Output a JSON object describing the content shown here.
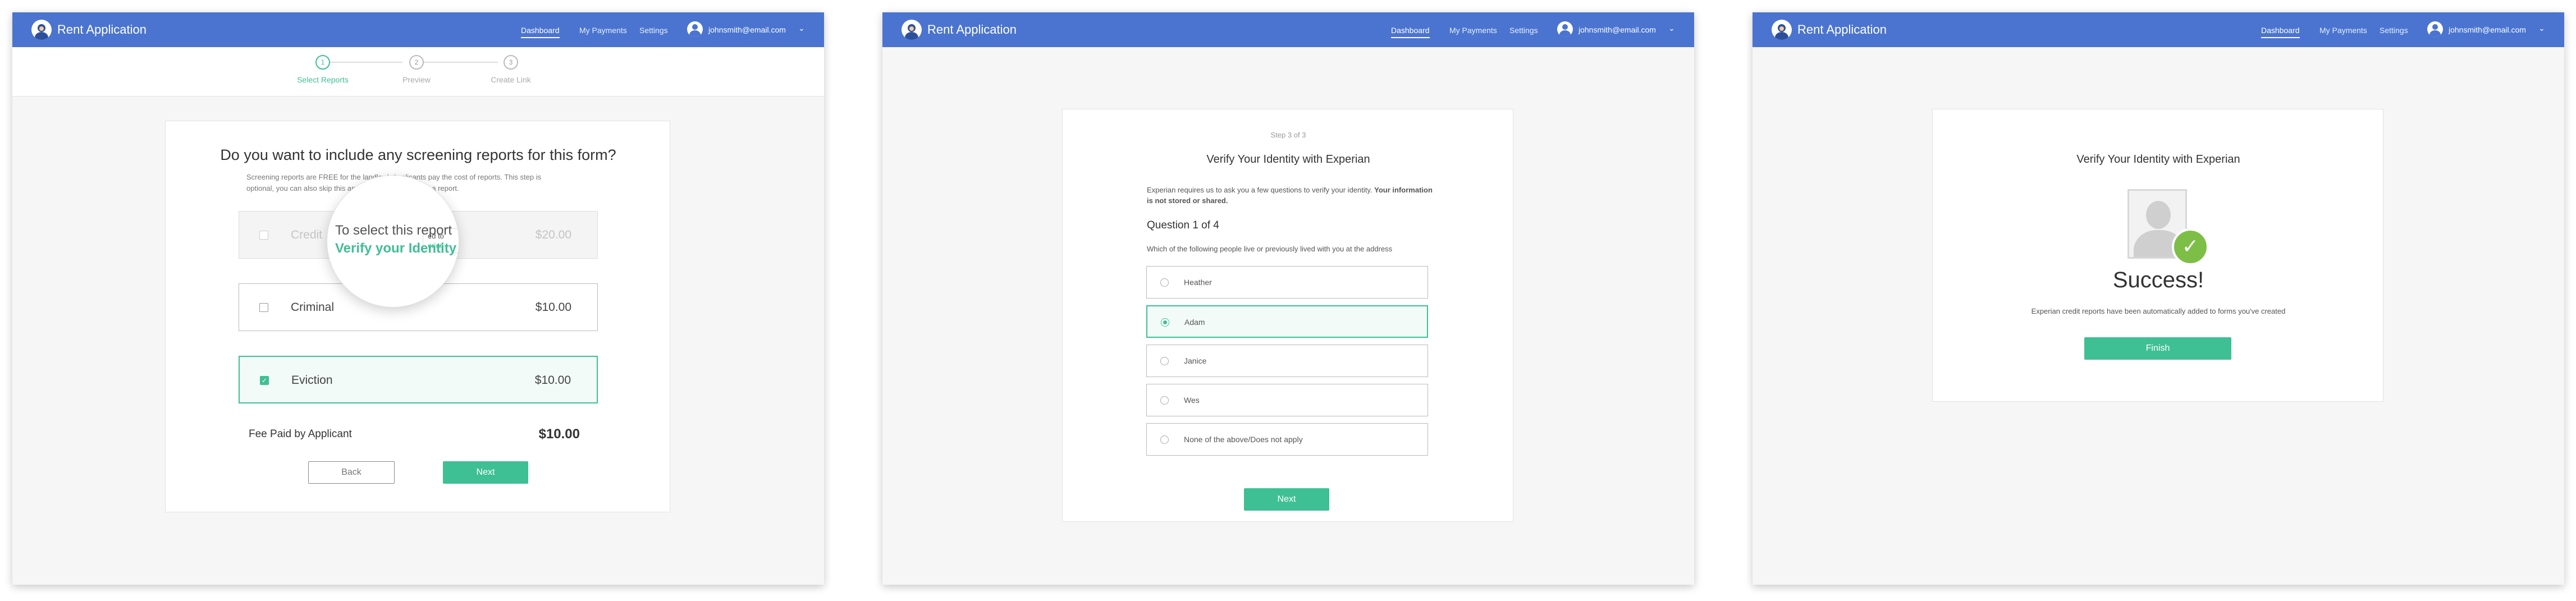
{
  "header": {
    "app_title": "Rent Application",
    "nav": [
      "Dashboard",
      "My Payments",
      "Settings"
    ],
    "user_email": "johnsmith@email.com"
  },
  "stepper": {
    "steps": [
      {
        "number": "1",
        "label": "Select Reports"
      },
      {
        "number": "2",
        "label": "Preview"
      },
      {
        "number": "3",
        "label": "Create Link"
      }
    ]
  },
  "screen1": {
    "title": "Do you want to include any screening reports for this form?",
    "description_line1": "Screening reports are FREE for the landlord. Applicants pay the cost of reports. This step is",
    "description_line2": "optional, you can also skip this and create a form without a report.",
    "options": [
      {
        "label": "Credit",
        "price": "$20.00",
        "state": "disabled"
      },
      {
        "label": "Criminal",
        "price": "$10.00",
        "state": "unchecked"
      },
      {
        "label": "Eviction",
        "price": "$10.00",
        "state": "checked"
      }
    ],
    "fee_label": "Fee Paid by Applicant",
    "fee_value": "$10.00",
    "back_label": "Back",
    "next_label": "Next",
    "magnifier": {
      "line1": "To select this report",
      "line2": "Verify your Identity",
      "small1": "ed to",
      "small2": "erian"
    }
  },
  "screen2": {
    "step_indicator": "Step 3 of 3",
    "title": "Verify Your Identity with Experian",
    "intro_plain": "Experian requires us to ask you a few questions to verify your identity.",
    "intro_bold_1": "Your",
    "intro_bold_2": "information is not stored or shared.",
    "question_heading": "Question 1 of 4",
    "question_text": "Which of the following people live or previously lived with you at the address",
    "answers": [
      {
        "label": "Heather",
        "selected": false
      },
      {
        "label": "Adam",
        "selected": true
      },
      {
        "label": "Janice",
        "selected": false
      },
      {
        "label": "Wes",
        "selected": false
      },
      {
        "label": "None of the above/Does not apply",
        "selected": false
      }
    ],
    "next_label": "Next"
  },
  "screen3": {
    "title": "Verify Your Identity with Experian",
    "success_heading": "Success!",
    "success_message": "Experian credit reports have been automatically added to forms you've created",
    "finish_label": "Finish"
  },
  "colors": {
    "header_blue": "#4a74cf",
    "accent_green": "#3fbf94",
    "success_badge_green": "#7dbe47"
  }
}
